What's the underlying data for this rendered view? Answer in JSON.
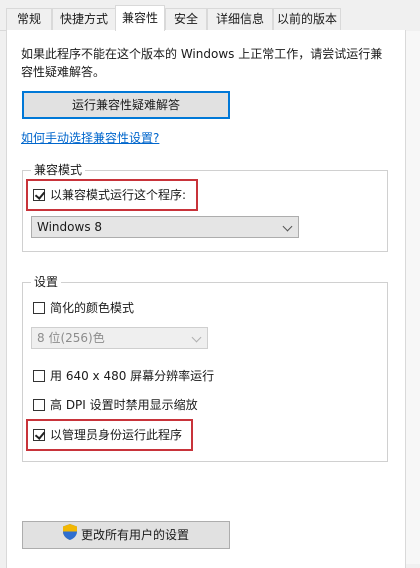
{
  "tabs": [
    {
      "label": "常规",
      "active": false
    },
    {
      "label": "快捷方式",
      "active": false
    },
    {
      "label": "兼容性",
      "active": true
    },
    {
      "label": "安全",
      "active": false
    },
    {
      "label": "详细信息",
      "active": false
    },
    {
      "label": "以前的版本",
      "active": false
    }
  ],
  "intro": {
    "line1": "如果此程序不能在这个版本的 Windows 上正常工作，请尝试运行兼",
    "line2": "容性疑难解答。"
  },
  "troubleshooter_button": "运行兼容性疑难解答",
  "manual_link": "如何手动选择兼容性设置?",
  "compat_mode": {
    "title": "兼容模式",
    "checkbox_label": "以兼容模式运行这个程序:",
    "checked": true,
    "selected_os": "Windows 8"
  },
  "settings": {
    "title": "设置",
    "reduced_color": {
      "label": "简化的颜色模式",
      "checked": false
    },
    "color_select": "8 位(256)色",
    "res_640": {
      "label": "用 640 x 480 屏幕分辨率运行",
      "checked": false
    },
    "high_dpi": {
      "label": "高 DPI 设置时禁用显示缩放",
      "checked": false
    },
    "run_as_admin": {
      "label": "以管理员身份运行此程序",
      "checked": true
    }
  },
  "all_users_button": "更改所有用户的设置",
  "colors": {
    "highlight": "#c8333a",
    "link": "#0066cc",
    "focus": "#0078d7"
  }
}
